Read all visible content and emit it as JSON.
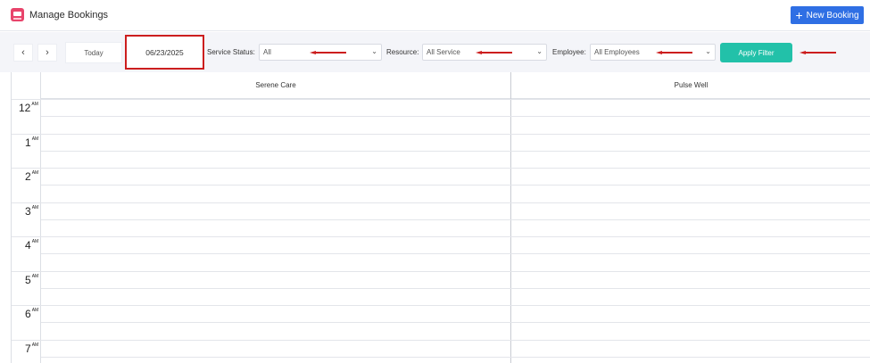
{
  "header": {
    "title": "Manage Bookings",
    "new_booking_label": "New Booking"
  },
  "toolbar": {
    "prev_icon": "‹",
    "next_icon": "›",
    "today_label": "Today",
    "date_value": "06/23/2025",
    "service_status_label": "Service Status:",
    "service_status_value": "All",
    "resource_label": "Resource:",
    "resource_value": "All Service",
    "employee_label": "Employee:",
    "employee_value": "All Employees",
    "apply_label": "Apply Filter"
  },
  "calendar": {
    "columns": [
      "Serene Care",
      "Pulse Well"
    ],
    "hours": [
      {
        "num": "12",
        "ampm": "AM"
      },
      {
        "num": "1",
        "ampm": "AM"
      },
      {
        "num": "2",
        "ampm": "AM"
      },
      {
        "num": "3",
        "ampm": "AM"
      },
      {
        "num": "4",
        "ampm": "AM"
      },
      {
        "num": "5",
        "ampm": "AM"
      },
      {
        "num": "6",
        "ampm": "AM"
      },
      {
        "num": "7",
        "ampm": "AM"
      }
    ]
  },
  "colors": {
    "primary": "#2f6fe4",
    "accent": "#22c1a9",
    "highlight": "#cc1e1e",
    "logo": "#e8446b"
  }
}
